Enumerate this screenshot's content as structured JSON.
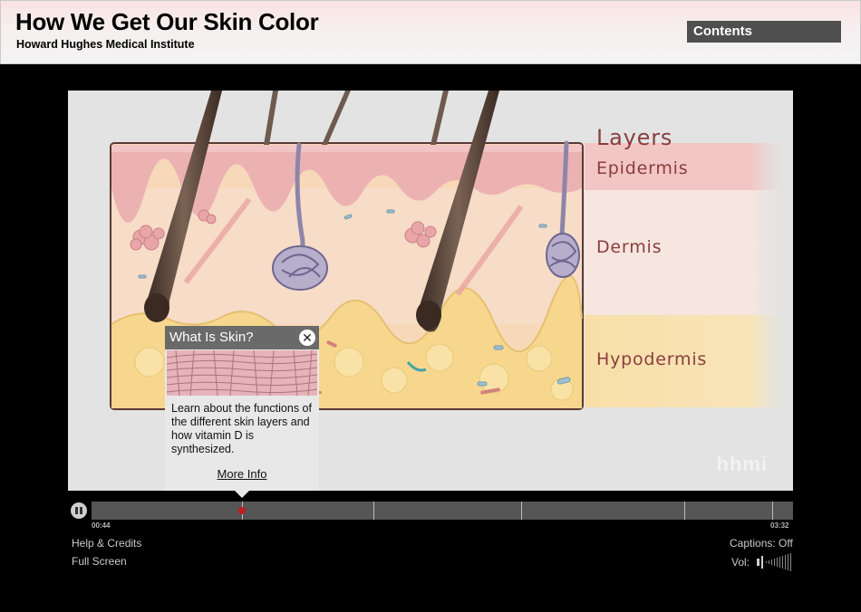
{
  "header": {
    "title": "How We Get Our Skin Color",
    "subtitle": "Howard Hughes Medical Institute",
    "contents_label": "Contents"
  },
  "illustration": {
    "layers_heading": "Layers",
    "layers": [
      "Epidermis",
      "Dermis",
      "Hypodermis"
    ],
    "watermark": "hhmi"
  },
  "popup": {
    "title": "What Is Skin?",
    "close_glyph": "✕",
    "body": "Learn about the functions of the different skin layers and how vitamin D is synthesized.",
    "link": "More Info"
  },
  "player": {
    "current_time": "00:44",
    "total_time": "03:32",
    "progress_fraction": 0.215,
    "chapter_marks": [
      0.215,
      0.402,
      0.613,
      0.845,
      0.97
    ],
    "state": "playing"
  },
  "footer": {
    "help_label": "Help & Credits",
    "fullscreen_label": "Full Screen",
    "captions_label": "Captions: Off",
    "volume_label": "Vol:"
  },
  "colors": {
    "accent": "#c21d1d",
    "label_color": "#8a3d3d",
    "contents_bg": "#4f4f4f"
  },
  "icons": [
    "pause-icon",
    "close-icon",
    "volume-icon"
  ]
}
